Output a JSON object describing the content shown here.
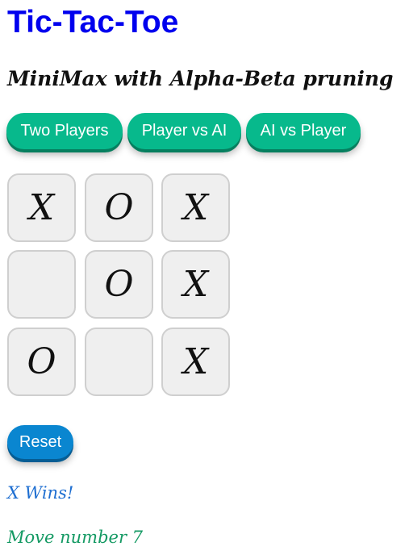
{
  "title": "Tic-Tac-Toe",
  "subtitle": "MiniMax with Alpha-Beta pruning",
  "mode_buttons": {
    "two_players": "Two Players",
    "player_vs_ai": "Player vs AI",
    "ai_vs_player": "AI vs Player"
  },
  "board": [
    [
      "X",
      "O",
      "X"
    ],
    [
      "",
      "O",
      "X"
    ],
    [
      "O",
      "",
      "X"
    ]
  ],
  "reset_label": "Reset",
  "status_text": "X Wins!",
  "move_text": "Move number 7",
  "colors": {
    "title": "#0000ee",
    "mode_button": "#07b98c",
    "reset_button": "#0a86d0",
    "status": "#1f6fd1",
    "move": "#159a64"
  }
}
